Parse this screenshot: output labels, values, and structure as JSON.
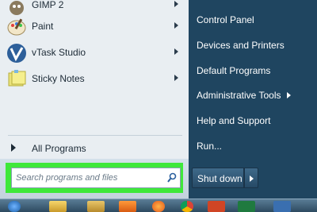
{
  "start_menu": {
    "programs": [
      {
        "label": "GIMP 2",
        "icon": "gimp-icon",
        "has_submenu": true
      },
      {
        "label": "Paint",
        "icon": "paint-palette-icon",
        "has_submenu": true
      },
      {
        "label": "vTask Studio",
        "icon": "vtask-studio-icon",
        "has_submenu": true
      },
      {
        "label": "Sticky Notes",
        "icon": "sticky-notes-icon",
        "has_submenu": true
      }
    ],
    "all_programs_label": "All Programs",
    "search": {
      "placeholder": "Search programs and files",
      "value": ""
    },
    "right_items": [
      {
        "label": "Control Panel",
        "has_submenu": false
      },
      {
        "label": "Devices and Printers",
        "has_submenu": false
      },
      {
        "label": "Default Programs",
        "has_submenu": false
      },
      {
        "label": "Administrative Tools",
        "has_submenu": true
      },
      {
        "label": "Help and Support",
        "has_submenu": false
      },
      {
        "label": "Run...",
        "has_submenu": false
      }
    ],
    "shutdown_label": "Shut down"
  },
  "taskbar": {
    "icons": [
      "start-orb-icon",
      "file-explorer-icon",
      "folder-icon",
      "media-player-icon",
      "firefox-icon",
      "chrome-icon",
      "powerpoint-icon",
      "excel-icon",
      "app-icon"
    ]
  },
  "colors": {
    "highlight": "#3ee83a",
    "right_pane_bg": "#1f4560",
    "left_pane_bg": "#e9eef2"
  }
}
